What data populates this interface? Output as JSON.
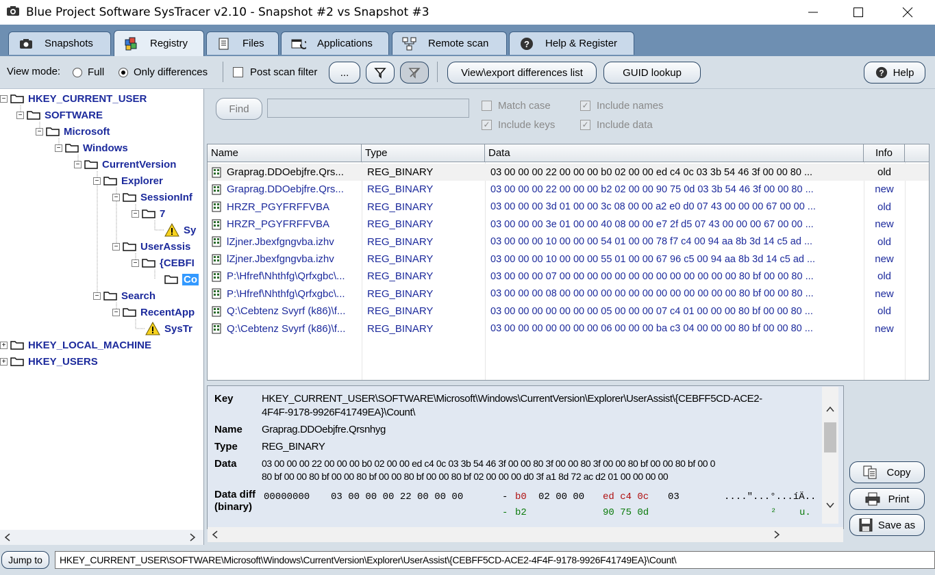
{
  "window": {
    "title": "Blue Project Software SysTracer v2.10 - Snapshot #2 vs Snapshot #3"
  },
  "tabs": [
    {
      "label": "Snapshots",
      "icon": "camera-icon"
    },
    {
      "label": "Registry",
      "icon": "registry-icon"
    },
    {
      "label": "Files",
      "icon": "file-icon"
    },
    {
      "label": "Applications",
      "icon": "applications-icon"
    },
    {
      "label": "Remote scan",
      "icon": "network-icon"
    },
    {
      "label": "Help & Register",
      "icon": "help-icon"
    }
  ],
  "toolbar": {
    "view_mode_label": "View mode:",
    "full_label": "Full",
    "only_diff_label": "Only differences",
    "post_scan_label": "Post scan filter",
    "ellipsis_label": "...",
    "view_export_label": "View\\export differences list",
    "guid_label": "GUID lookup",
    "help_label": "Help"
  },
  "tree": {
    "nodes": [
      {
        "label": "HKEY_CURRENT_USER"
      },
      {
        "label": "SOFTWARE"
      },
      {
        "label": "Microsoft"
      },
      {
        "label": "Windows"
      },
      {
        "label": "CurrentVersion"
      },
      {
        "label": "Explorer"
      },
      {
        "label": "SessionInf"
      },
      {
        "label": "7"
      },
      {
        "label": "Sy"
      },
      {
        "label": "UserAssis"
      },
      {
        "label": "{CEBFI"
      },
      {
        "label": "Co"
      },
      {
        "label": "Search"
      },
      {
        "label": "RecentApp"
      },
      {
        "label": "SysTr"
      },
      {
        "label": "HKEY_LOCAL_MACHINE"
      },
      {
        "label": "HKEY_USERS"
      }
    ]
  },
  "find": {
    "button_label": "Find",
    "input_value": "",
    "match_case": "Match case",
    "include_keys": "Include keys",
    "include_names": "Include names",
    "include_data": "Include data"
  },
  "grid": {
    "headers": [
      "Name",
      "Type",
      "Data",
      "Info"
    ],
    "rows": [
      {
        "name": "Graprag.DDOebjfre.Qrs...",
        "type": "REG_BINARY",
        "data": "03 00 00 00 22 00 00 00 b0 02 00 00 ed c4 0c 03 3b 54 46 3f 00 00 80 ...",
        "info": "old"
      },
      {
        "name": "Graprag.DDOebjfre.Qrs...",
        "type": "REG_BINARY",
        "data": "03 00 00 00 22 00 00 00 b2 02 00 00 90 75 0d 03 3b 54 46 3f 00 00 80 ...",
        "info": "new"
      },
      {
        "name": "HRZR_PGYFRFFVBA",
        "type": "REG_BINARY",
        "data": "03 00 00 00 3d 01 00 00 3c 08 00 00 a2 e0 d0 07 43 00 00 00 67 00 00 ...",
        "info": "old"
      },
      {
        "name": "HRZR_PGYFRFFVBA",
        "type": "REG_BINARY",
        "data": "03 00 00 00 3e 01 00 00 40 08 00 00 e7 2f d5 07 43 00 00 00 67 00 00 ...",
        "info": "new"
      },
      {
        "name": "lZjner.Jbexfgngvba.izhv",
        "type": "REG_BINARY",
        "data": "03 00 00 00 10 00 00 00 54 01 00 00 78 f7 c4 00 94 aa 8b 3d 14 c5 ad ...",
        "info": "old"
      },
      {
        "name": "lZjner.Jbexfgngvba.izhv",
        "type": "REG_BINARY",
        "data": "03 00 00 00 10 00 00 00 55 01 00 00 67 96 c5 00 94 aa 8b 3d 14 c5 ad ...",
        "info": "new"
      },
      {
        "name": "P:\\Hfref\\Nhthfg\\Qrfxgbc\\...",
        "type": "REG_BINARY",
        "data": "03 00 00 00 07 00 00 00 00 00 00 00 00 00 00 00 00 00 80 bf 00 00 80 ...",
        "info": "old"
      },
      {
        "name": "P:\\Hfref\\Nhthfg\\Qrfxgbc\\...",
        "type": "REG_BINARY",
        "data": "03 00 00 00 08 00 00 00 00 00 00 00 00 00 00 00 00 00 80 bf 00 00 80 ...",
        "info": "new"
      },
      {
        "name": "Q:\\Cebtenz Svyrf (k86)\\f...",
        "type": "REG_BINARY",
        "data": "03 00 00 00 00 00 00 00 05 00 00 00 07 c4 01 00 00 00 80 bf 00 00 80 ...",
        "info": "old"
      },
      {
        "name": "Q:\\Cebtenz Svyrf (k86)\\f...",
        "type": "REG_BINARY",
        "data": "03 00 00 00 00 00 00 00 06 00 00 00 ba c3 04 00 00 00 80 bf 00 00 80 ...",
        "info": "new"
      }
    ]
  },
  "details": {
    "key_label": "Key",
    "key_line1": "HKEY_CURRENT_USER\\SOFTWARE\\Microsoft\\Windows\\CurrentVersion\\Explorer\\UserAssist\\{CEBFF5CD-ACE2-",
    "key_line2": "4F4F-9178-9926F41749EA}\\Count\\",
    "name_label": "Name",
    "name_value": "Graprag.DDOebjfre.Qrsnhyg",
    "type_label": "Type",
    "type_value": "REG_BINARY",
    "data_label": "Data",
    "data_line1": "03 00 00 00 22 00 00 00 b0 02 00 00 ed c4 0c 03 3b 54 46 3f 00 00 80 3f 00 00 80 3f 00 00 80 bf 00 00 80 bf 00 0",
    "data_line2": "80 bf 00 00 80 bf 00 00 80 bf 00 00 80 bf 00 00 80 bf 02 00 00 00 d0 3f a1 8d 72 ac d2 01 00 00 00 00",
    "diff_label": "Data diff (binary)",
    "diff_row1_offset": "00000000",
    "diff_row1_bytes": "03 00 00 00 22 00 00 00",
    "diff_row1_sep": "-",
    "diff_row1_b1": "b0",
    "diff_row1_b2": "02 00 00",
    "diff_row1_b3": "ed c4 0c",
    "diff_row1_b4": "03",
    "diff_row1_ascii": "....\"...°...íÄ..",
    "diff_row2_sep": "-",
    "diff_row2_b1": "b2",
    "diff_row2_b3": "90 75 0d",
    "diff_row2_ascii": "²    u."
  },
  "side_buttons": {
    "copy": "Copy",
    "print": "Print",
    "save_as": "Save as"
  },
  "statusbar": {
    "jump_label": "Jump to",
    "jump_value": "HKEY_CURRENT_USER\\SOFTWARE\\Microsoft\\Windows\\CurrentVersion\\Explorer\\UserAssist\\{CEBFF5CD-ACE2-4F4F-9178-9926F41749EA}\\Count\\"
  },
  "colors": {
    "accent": "#1c2a9c",
    "tab_strip": "#6e8fb2",
    "selection": "#3399ff",
    "diff_red": "#b01010",
    "diff_green": "#0a7a0a"
  }
}
